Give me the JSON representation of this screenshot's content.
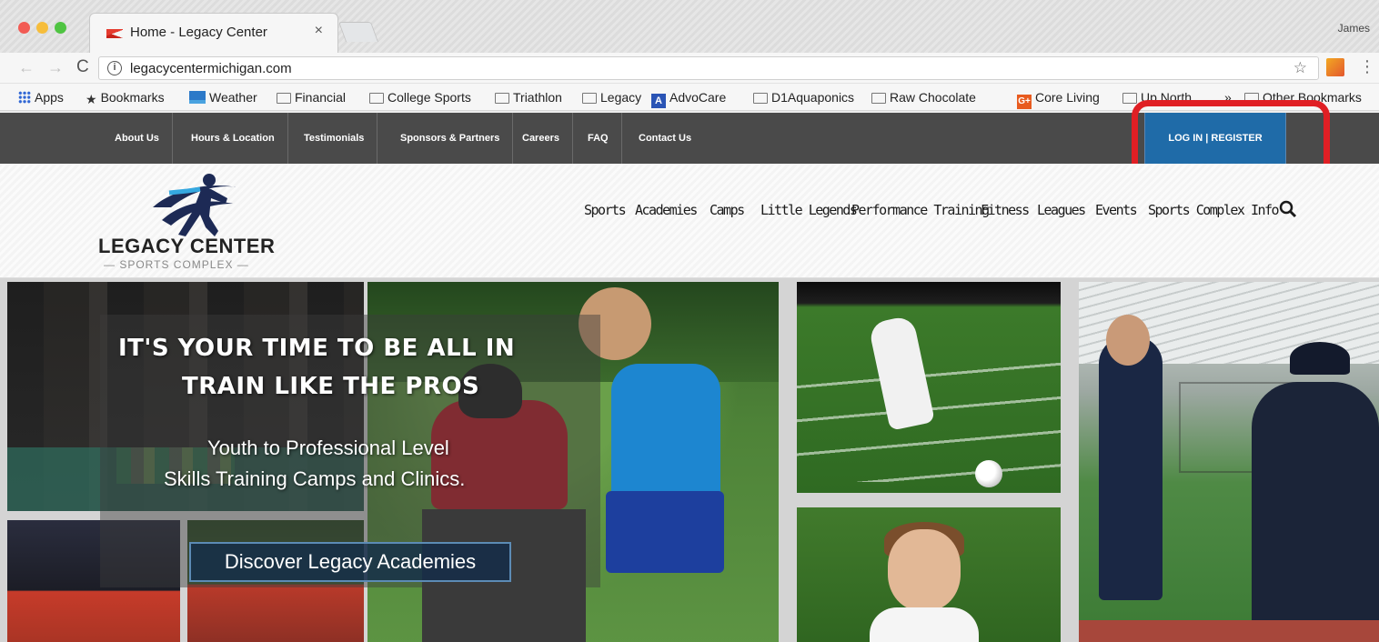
{
  "browser": {
    "tab_title": "Home - Legacy Center",
    "tab_close": "×",
    "profile_name": "James",
    "url": "legacycentermichigan.com",
    "info_glyph": "i",
    "nav_back": "←",
    "nav_forward": "→",
    "nav_reload": "C",
    "star_glyph": "☆",
    "menu_glyph": "⋮",
    "bookmarks": [
      {
        "label": "Apps",
        "icon": "apps-grid-icon"
      },
      {
        "label": "Bookmarks",
        "icon": "star-icon"
      },
      {
        "label": "Weather",
        "icon": "weather-icon"
      },
      {
        "label": "Financial",
        "icon": "folder-icon"
      },
      {
        "label": "College Sports",
        "icon": "folder-icon"
      },
      {
        "label": "Triathlon",
        "icon": "folder-icon"
      },
      {
        "label": "Legacy",
        "icon": "folder-icon"
      },
      {
        "label": "AdvoCare",
        "icon": "advocare-icon"
      },
      {
        "label": "D1Aquaponics",
        "icon": "folder-icon"
      },
      {
        "label": "Raw Chocolate",
        "icon": "folder-icon"
      },
      {
        "label": "Core Living",
        "icon": "core-living-icon"
      },
      {
        "label": "Up North",
        "icon": "folder-icon"
      },
      {
        "label": "»",
        "icon": ""
      },
      {
        "label": "Other Bookmarks",
        "icon": "folder-icon"
      }
    ],
    "bookmark_star_glyph": "★",
    "advocare_glyph": "A",
    "core_glyph": "G+"
  },
  "site": {
    "topnav": [
      "About Us",
      "Hours & Location",
      "Testimonials",
      "Sponsors & Partners",
      "Careers",
      "FAQ",
      "Contact Us"
    ],
    "login_label": "LOG IN | REGISTER",
    "logo_title": "LEGACY CENTER",
    "logo_sub": "— SPORTS COMPLEX —",
    "mainnav": [
      "Sports",
      "Academies",
      "Camps",
      "Little Legends",
      "Performance Training",
      "Fitness",
      "Leagues",
      "Events",
      "Sports Complex Info"
    ],
    "search_glyph": "🔍",
    "hero": {
      "line1": "IT'S YOUR TIME TO BE ALL IN",
      "line2": "TRAIN LIKE THE PROS",
      "sub1": "Youth to Professional Level",
      "sub2": "Skills Training Camps and Clinics.",
      "cta": "Discover Legacy Academies"
    }
  },
  "colors": {
    "topnav_bg": "#4a4a4a",
    "login_bg": "#1f6ba8",
    "highlight": "#e01f24"
  }
}
